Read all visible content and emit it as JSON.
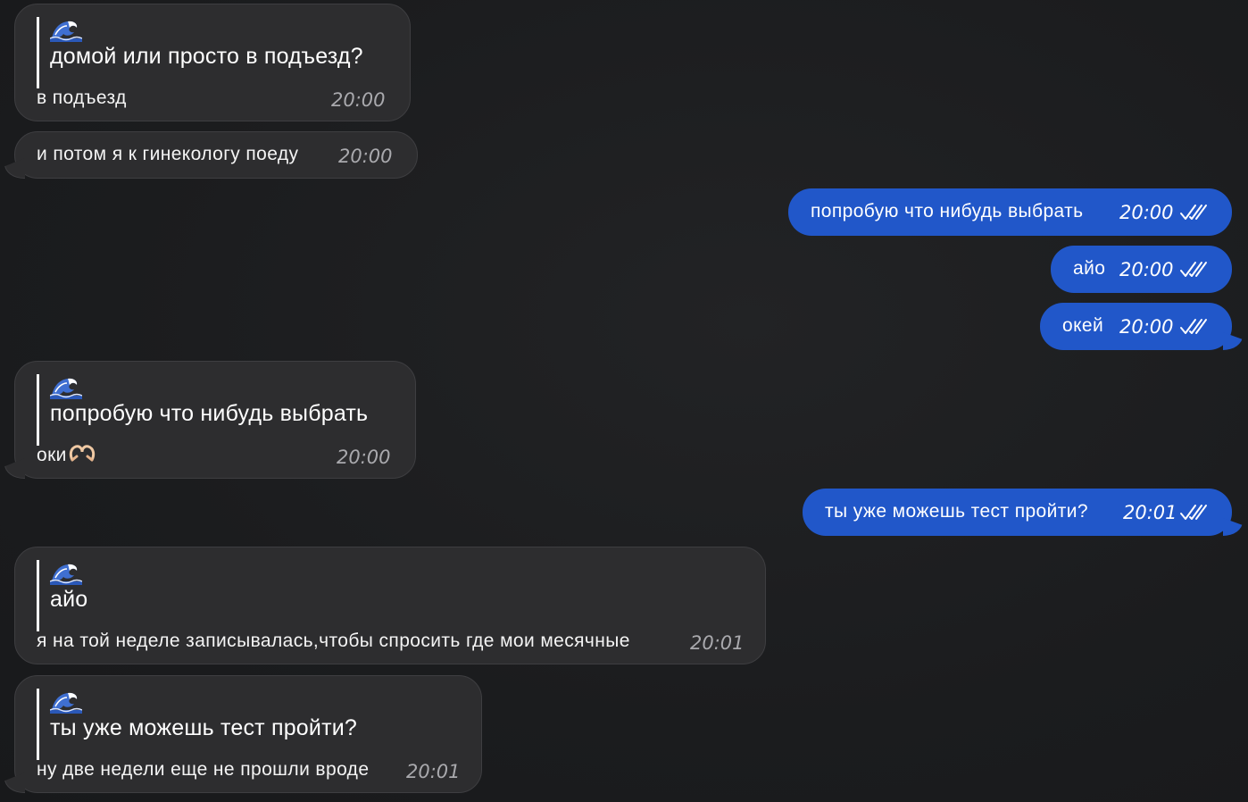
{
  "messages": [
    {
      "id": "m1",
      "direction": "incoming",
      "reply_icon": "wave-emoji-icon",
      "reply_text": "домой или просто в подъезд?",
      "text": "в подъезд",
      "time": "20:00"
    },
    {
      "id": "m2",
      "direction": "incoming",
      "text": "и потом я к гинекологу поеду",
      "time": "20:00"
    },
    {
      "id": "m3",
      "direction": "outgoing",
      "text": "попробую что нибудь выбрать",
      "time": "20:00",
      "status": "read"
    },
    {
      "id": "m4",
      "direction": "outgoing",
      "text": "айо",
      "time": "20:00",
      "status": "read"
    },
    {
      "id": "m5",
      "direction": "outgoing",
      "text": "окей",
      "time": "20:00",
      "status": "read"
    },
    {
      "id": "m6",
      "direction": "incoming",
      "reply_icon": "wave-emoji-icon",
      "reply_text": "попробую что нибудь выбрать",
      "text": "оки",
      "emoji": "heart-hands-emoji-icon",
      "time": "20:00"
    },
    {
      "id": "m7",
      "direction": "outgoing",
      "text": "ты уже можешь тест пройти?",
      "time": "20:01",
      "status": "read"
    },
    {
      "id": "m8",
      "direction": "incoming",
      "reply_icon": "wave-emoji-icon",
      "reply_text": "айо",
      "text": "я на той неделе записывалась,чтобы спросить где мои месячные",
      "time": "20:01"
    },
    {
      "id": "m9",
      "direction": "incoming",
      "reply_icon": "wave-emoji-icon",
      "reply_text": "ты уже можешь тест пройти?",
      "text": "ну две недели еще не прошли вроде",
      "time": "20:01"
    }
  ],
  "colors": {
    "background": "#1c1d1f",
    "incoming_bubble": "#2d2d2f",
    "outgoing_bubble": "#2157c9",
    "time_incoming": "#a9a9ad",
    "time_outgoing": "#ffffff"
  }
}
